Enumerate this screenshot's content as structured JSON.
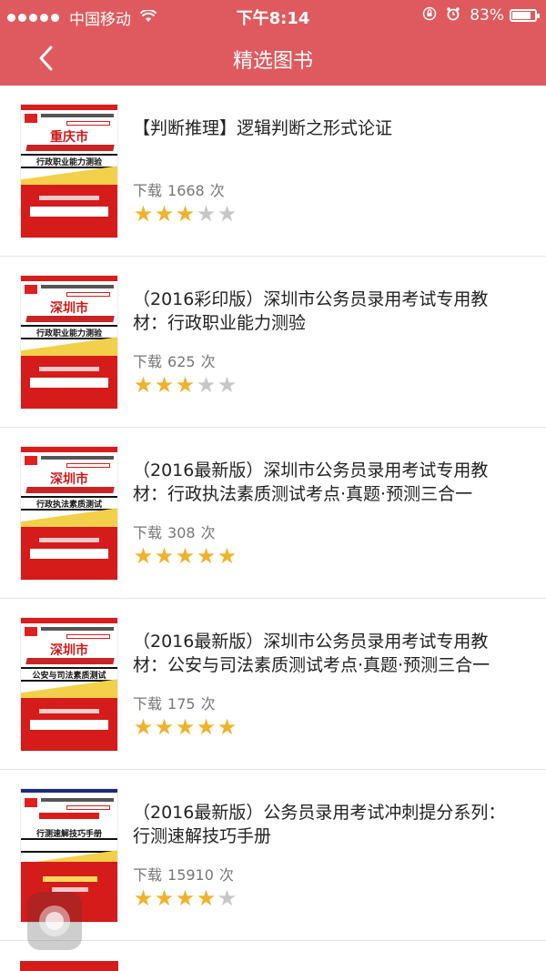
{
  "status_bar": {
    "carrier": "中国移动",
    "time": "下午8:14",
    "battery_text": "83%",
    "battery_level": 0.83,
    "signal_icon": "signal-dots-icon",
    "wifi_icon": "wifi-icon",
    "lock_icon": "orientation-lock-icon",
    "alarm_icon": "alarm-icon"
  },
  "nav": {
    "title": "精选图书",
    "back_icon": "back-chevron-icon"
  },
  "colors": {
    "header": "#df5a5e",
    "star_on": "#f0b22b",
    "star_off": "#c7c7c7"
  },
  "books": [
    {
      "title": "【判断推理】逻辑判断之形式论证",
      "download_label": "下载",
      "download_count": "1668",
      "download_unit": "次",
      "rating": 3,
      "cover_city": "重庆市",
      "cover_subtitle": "行政职业能力测验"
    },
    {
      "title": "（2016彩印版）深圳市公务员录用考试专用教材：行政职业能力测验",
      "download_label": "下载",
      "download_count": "625",
      "download_unit": "次",
      "rating": 3,
      "cover_city": "深圳市",
      "cover_subtitle": "行政职业能力测验"
    },
    {
      "title": "（2016最新版）深圳市公务员录用考试专用教材：行政执法素质测试考点·真题·预测三合一",
      "download_label": "下载",
      "download_count": "308",
      "download_unit": "次",
      "rating": 5,
      "cover_city": "深圳市",
      "cover_subtitle": "行政执法素质测试"
    },
    {
      "title": "（2016最新版）深圳市公务员录用考试专用教材：公安与司法素质测试考点·真题·预测三合一",
      "download_label": "下载",
      "download_count": "175",
      "download_unit": "次",
      "rating": 5,
      "cover_city": "深圳市",
      "cover_subtitle": "公安与司法素质测试"
    },
    {
      "title": "（2016最新版）公务员录用考试冲刺提分系列：行测速解技巧手册",
      "download_label": "下载",
      "download_count": "15910",
      "download_unit": "次",
      "rating": 4,
      "cover_city": "",
      "cover_subtitle": "行测速解技巧手册"
    }
  ]
}
